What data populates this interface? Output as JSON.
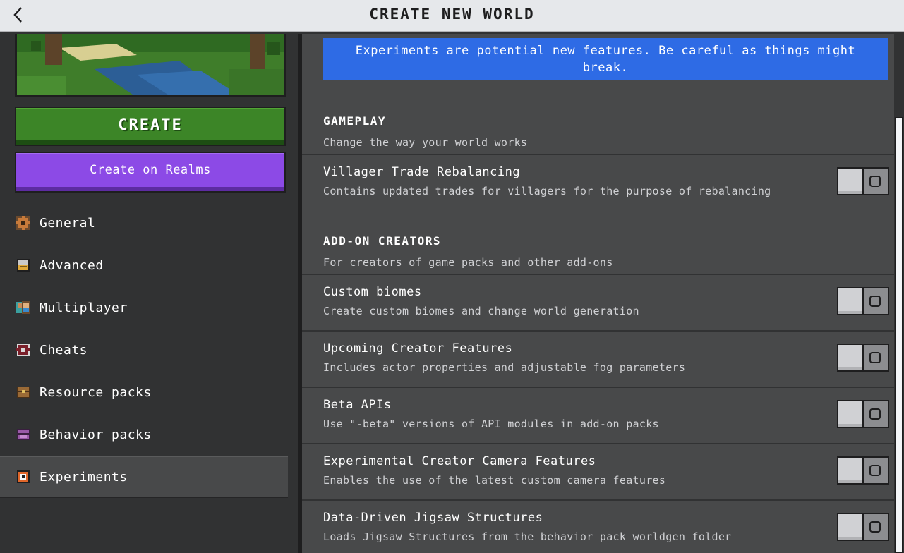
{
  "header": {
    "title": "CREATE NEW WORLD",
    "back_icon": "chevron-left-icon"
  },
  "left": {
    "create_label": "CREATE",
    "realms_label": "Create on Realms",
    "nav": [
      {
        "label": "General",
        "icon": "general-icon"
      },
      {
        "label": "Advanced",
        "icon": "advanced-icon"
      },
      {
        "label": "Multiplayer",
        "icon": "multiplayer-icon"
      },
      {
        "label": "Cheats",
        "icon": "cheats-icon"
      },
      {
        "label": "Resource packs",
        "icon": "resource-packs-icon"
      },
      {
        "label": "Behavior packs",
        "icon": "behavior-packs-icon"
      },
      {
        "label": "Experiments",
        "icon": "experiments-icon",
        "active": true
      }
    ]
  },
  "main": {
    "notice": "Experiments are potential new features. Be careful as things might break.",
    "sections": [
      {
        "title": "GAMEPLAY",
        "subtitle": "Change the way your world works",
        "items": [
          {
            "title": "Villager Trade Rebalancing",
            "desc": "Contains updated trades for villagers for the purpose of rebalancing",
            "enabled": false
          }
        ]
      },
      {
        "title": "ADD-ON CREATORS",
        "subtitle": "For creators of game packs and other add-ons",
        "items": [
          {
            "title": "Custom biomes",
            "desc": "Create custom biomes and change world generation",
            "enabled": false
          },
          {
            "title": "Upcoming Creator Features",
            "desc": "Includes actor properties and adjustable fog parameters",
            "enabled": false
          },
          {
            "title": "Beta APIs",
            "desc": "Use \"-beta\" versions of API modules in add-on packs",
            "enabled": false
          },
          {
            "title": "Experimental Creator Camera Features",
            "desc": "Enables the use of the latest custom camera features",
            "enabled": false
          },
          {
            "title": "Data-Driven Jigsaw Structures",
            "desc": "Loads Jigsaw Structures from the behavior pack worldgen folder",
            "enabled": false
          }
        ]
      }
    ]
  },
  "colors": {
    "header_bg": "#e6e8eb",
    "create_green": "#3c8527",
    "realms_purple": "#8c4ae6",
    "notice_blue": "#2e6be5",
    "panel_dark": "#313233",
    "panel_mid": "#48494a"
  }
}
